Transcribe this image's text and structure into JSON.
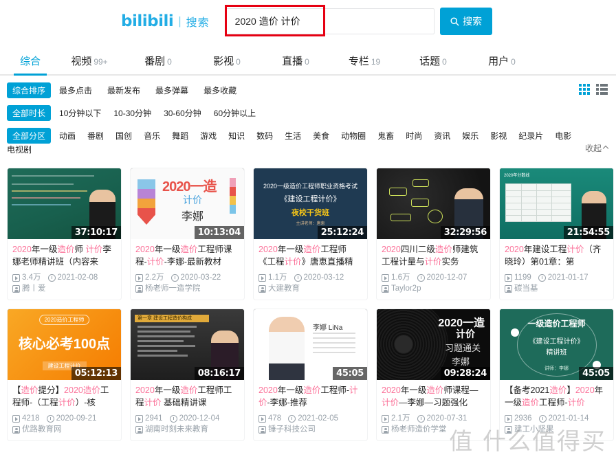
{
  "header": {
    "logo_text": "bilibili",
    "logo_divider": "|",
    "logo_sub": "搜索",
    "search_value": "2020 造价 计价",
    "search_placeholder": "",
    "search_button": "搜索"
  },
  "tabs": [
    {
      "label": "综合",
      "count": "",
      "active": true
    },
    {
      "label": "视频",
      "count": "99+",
      "active": false
    },
    {
      "label": "番剧",
      "count": "0",
      "active": false
    },
    {
      "label": "影视",
      "count": "0",
      "active": false
    },
    {
      "label": "直播",
      "count": "0",
      "active": false
    },
    {
      "label": "专栏",
      "count": "19",
      "active": false
    },
    {
      "label": "话题",
      "count": "0",
      "active": false
    },
    {
      "label": "用户",
      "count": "0",
      "active": false
    }
  ],
  "filters": {
    "sort_pill": "综合排序",
    "sort_options": [
      "最多点击",
      "最新发布",
      "最多弹幕",
      "最多收藏"
    ],
    "duration_pill": "全部时长",
    "duration_options": [
      "10分钟以下",
      "10-30分钟",
      "30-60分钟",
      "60分钟以上"
    ],
    "zone_pill": "全部分区",
    "zone_options": [
      "动画",
      "番剧",
      "国创",
      "音乐",
      "舞蹈",
      "游戏",
      "知识",
      "数码",
      "生活",
      "美食",
      "动物圈",
      "鬼畜",
      "时尚",
      "资讯",
      "娱乐",
      "影视",
      "纪录片",
      "电影",
      "电视剧"
    ],
    "collapse_label": "收起",
    "view_grid_icon": "grid-view-icon",
    "view_list_icon": "list-view-icon"
  },
  "cards": [
    {
      "duration": "37:10:17",
      "title_parts": [
        {
          "t": "2020",
          "hl": true
        },
        {
          "t": "年一级",
          "hl": false
        },
        {
          "t": "造价",
          "hl": true
        },
        {
          "t": "师 ",
          "hl": false
        },
        {
          "t": "计价",
          "hl": true
        },
        {
          "t": "李娜老师精讲班（内容来",
          "hl": false
        }
      ],
      "plays": "3.4万",
      "date": "2021-02-08",
      "uploader": "腾丨爱"
    },
    {
      "duration": "10:13:04",
      "title_parts": [
        {
          "t": "2020",
          "hl": true
        },
        {
          "t": "年一级",
          "hl": false
        },
        {
          "t": "造价",
          "hl": true
        },
        {
          "t": "工程师课程-",
          "hl": false
        },
        {
          "t": "计价",
          "hl": true
        },
        {
          "t": "-李娜-最新教材",
          "hl": false
        }
      ],
      "plays": "2.2万",
      "date": "2020-03-22",
      "uploader": "杨老师一造学院"
    },
    {
      "duration": "25:12:24",
      "title_parts": [
        {
          "t": "2020",
          "hl": true
        },
        {
          "t": "年一级",
          "hl": false
        },
        {
          "t": "造价",
          "hl": true
        },
        {
          "t": "工程师《工程",
          "hl": false
        },
        {
          "t": "计价",
          "hl": true
        },
        {
          "t": "》唐恵直播精",
          "hl": false
        }
      ],
      "plays": "1.1万",
      "date": "2020-03-12",
      "uploader": "大建教育"
    },
    {
      "duration": "32:29:56",
      "title_parts": [
        {
          "t": "2020",
          "hl": true
        },
        {
          "t": "四川二级",
          "hl": false
        },
        {
          "t": "造价",
          "hl": true
        },
        {
          "t": "师建筑工程计量与",
          "hl": false
        },
        {
          "t": "计价",
          "hl": true
        },
        {
          "t": "实务",
          "hl": false
        }
      ],
      "plays": "1.6万",
      "date": "2020-12-07",
      "uploader": "Taylor2p"
    },
    {
      "duration": "21:54:55",
      "title_parts": [
        {
          "t": "2020",
          "hl": true
        },
        {
          "t": "年建设工程",
          "hl": false
        },
        {
          "t": "计价",
          "hl": true
        },
        {
          "t": "（齐晓玲）第01章：第",
          "hl": false
        }
      ],
      "plays": "1199",
      "date": "2021-01-17",
      "uploader": "碳当基"
    },
    {
      "duration": "05:12:13",
      "title_parts": [
        {
          "t": "【",
          "hl": false
        },
        {
          "t": "造价",
          "hl": true
        },
        {
          "t": "提分】",
          "hl": false
        },
        {
          "t": "2020",
          "hl": true
        },
        {
          "t": "造价",
          "hl": true
        },
        {
          "t": "工程师-（工程",
          "hl": false
        },
        {
          "t": "计价",
          "hl": true
        },
        {
          "t": "）-核",
          "hl": false
        }
      ],
      "plays": "4218",
      "date": "2020-09-21",
      "uploader": "优路教育网"
    },
    {
      "duration": "08:16:17",
      "title_parts": [
        {
          "t": "2020",
          "hl": true
        },
        {
          "t": "年一级",
          "hl": false
        },
        {
          "t": "造价",
          "hl": true
        },
        {
          "t": "工程师工程",
          "hl": false
        },
        {
          "t": "计价",
          "hl": true
        },
        {
          "t": " 基础精讲课",
          "hl": false
        }
      ],
      "plays": "2941",
      "date": "2020-12-04",
      "uploader": "湖南时刻未来教育"
    },
    {
      "duration": "45:05",
      "title_parts": [
        {
          "t": "2020",
          "hl": true
        },
        {
          "t": "年一级",
          "hl": false
        },
        {
          "t": "造价",
          "hl": true
        },
        {
          "t": "工程师-",
          "hl": false
        },
        {
          "t": "计价",
          "hl": true
        },
        {
          "t": "-李娜-推荐",
          "hl": false
        }
      ],
      "plays": "478",
      "date": "2021-02-05",
      "uploader": "锤子科技公司"
    },
    {
      "duration": "09:28:24",
      "title_parts": [
        {
          "t": "2020",
          "hl": true
        },
        {
          "t": "年一级",
          "hl": false
        },
        {
          "t": "造价",
          "hl": true
        },
        {
          "t": "师课程—",
          "hl": false
        },
        {
          "t": "计价",
          "hl": true
        },
        {
          "t": "—李娜—习题强化",
          "hl": false
        }
      ],
      "plays": "2.1万",
      "date": "2020-07-31",
      "uploader": "杨老师造价学堂"
    },
    {
      "duration": "45:05",
      "title_parts": [
        {
          "t": "【备考2021",
          "hl": false
        },
        {
          "t": "造价",
          "hl": true
        },
        {
          "t": "】",
          "hl": false
        },
        {
          "t": "2020",
          "hl": true
        },
        {
          "t": "年一级",
          "hl": false
        },
        {
          "t": "造价",
          "hl": true
        },
        {
          "t": "工程师-",
          "hl": false
        },
        {
          "t": "计价",
          "hl": true
        }
      ],
      "plays": "2936",
      "date": "2021-01-14",
      "uploader": "建工小坚果"
    }
  ],
  "thumb_text": {
    "c2_year": "2020一造",
    "c2_sub1": "计价",
    "c2_sub2": "李娜",
    "c3_l1": "2020一级造价工程师职业资格考试",
    "c3_l2": "《建设工程计价》",
    "c3_l3": "夜校干货班",
    "c3_l4": "主讲老师：唐恵",
    "c6_tag": "2020造价工程师",
    "c6_big": "核心必考100点",
    "c6_tag2": "建设工程计价",
    "c7_band": "第一章 建设工程造价构成",
    "c8_name": "李娜 LiNa",
    "c9_t1": "2020一造",
    "c9_t2": "计价",
    "c9_t3": "习题通关",
    "c9_t4": "李娜",
    "c10_l1": "一级造价工程师",
    "c10_l2": "《建设工程计价》",
    "c10_l3": "精讲班",
    "c10_l4": "讲师：李娜"
  },
  "watermark": "值 什么值得买"
}
